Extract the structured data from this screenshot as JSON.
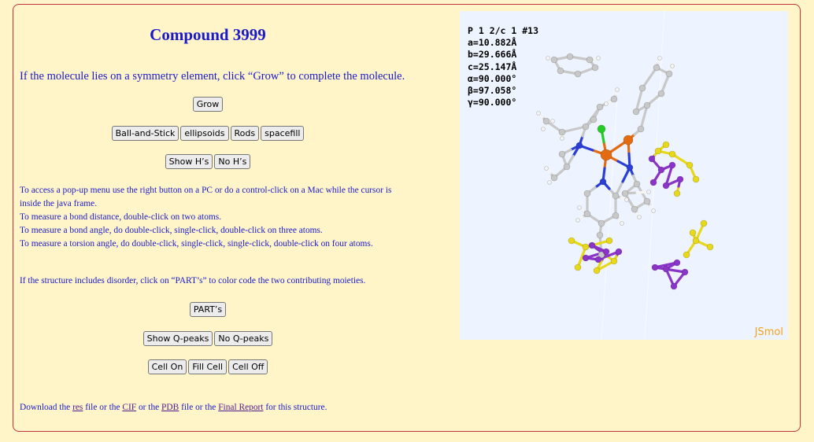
{
  "page": {
    "title": "Compound 3999",
    "intro": "If the molecule lies on a symmetry element, click “Grow” to complete the molecule."
  },
  "buttons": {
    "grow": "Grow",
    "styles": [
      "Ball-and-Stick",
      "ellipsoids",
      "Rods",
      "spacefill"
    ],
    "hydrogens": [
      "Show H’s",
      "No H’s"
    ],
    "parts": "PART’s",
    "qpeaks": [
      "Show Q-peaks",
      "No Q-peaks"
    ],
    "cell": [
      "Cell On",
      "Fill Cell",
      "Cell Off"
    ]
  },
  "help": [
    "To access a pop-up menu use the right button on a PC or do a control-click on a Mac while the cursor is inside the java frame.",
    "To measure a bond distance, double-click on two atoms.",
    "To measure a bond angle, do double-click, single-click, double-click on three atoms.",
    "To measure a torsion angle, do double-click, single-click, single-click, double-click on four atoms."
  ],
  "disorder": "If the structure includes disorder, click on “PART’s” to color code the two contributing moieties.",
  "download": {
    "t1": "Download the ",
    "res": "res",
    "t2": " file or the ",
    "cif": "CIF",
    "t3": " or the ",
    "pdb": "PDB",
    "t4": " file or the ",
    "report": "Final Report",
    "t5": " for this structure."
  },
  "viewer": {
    "cell_params": [
      "P 1 2/c 1 #13",
      "a=10.882Å",
      "b=29.666Å",
      "c=25.147Å",
      "α=90.000°",
      "β=97.058°",
      "γ=90.000°"
    ],
    "brand": "JSmol",
    "colors": {
      "carbon": "#c8c8c8",
      "nitrogen": "#2b3fd6",
      "metal": "#e46c10",
      "chlorine": "#22cc22",
      "part_a": "#e8d81a",
      "part_b": "#8a34c8"
    }
  }
}
